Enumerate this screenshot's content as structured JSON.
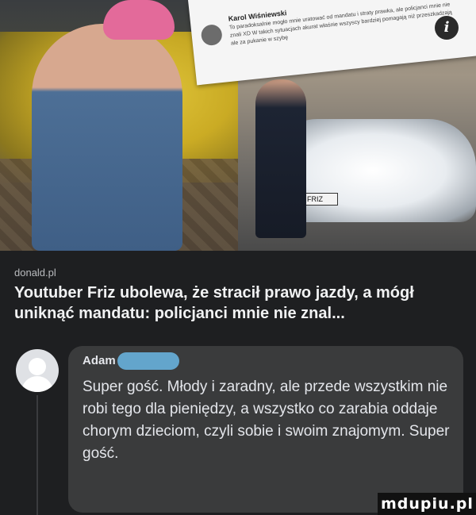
{
  "photo": {
    "notification_name": "Karol Wiśniewski",
    "notification_text": "To paradoksalnie mogło mnie uratować od mandatu i straty prawka, ale policjanci mnie nie znali XD W takich sytuacjach akurat właśnie wszyscy bardziej pomagają niż przeszkadzają ale za pukanie w szybę",
    "plate_text": "FRIZ",
    "info_icon": "info-icon"
  },
  "post": {
    "source": "donald.pl",
    "headline": "Youtuber Friz ubolewa, że stracił prawo jazdy, a mógł uniknąć mandatu: policjanci mnie nie znal..."
  },
  "comment": {
    "author": "Adam",
    "avatar_icon": "default-user-avatar-icon",
    "text": "Super gość. Młody i zaradny, ale przede wszystkim nie robi tego dla pieniędzy, a wszystko co zarabia oddaje chorym dzieciom, czyli sobie i swoim znajomym. Super gość."
  },
  "watermark": {
    "text": "mdupiu.pl"
  }
}
